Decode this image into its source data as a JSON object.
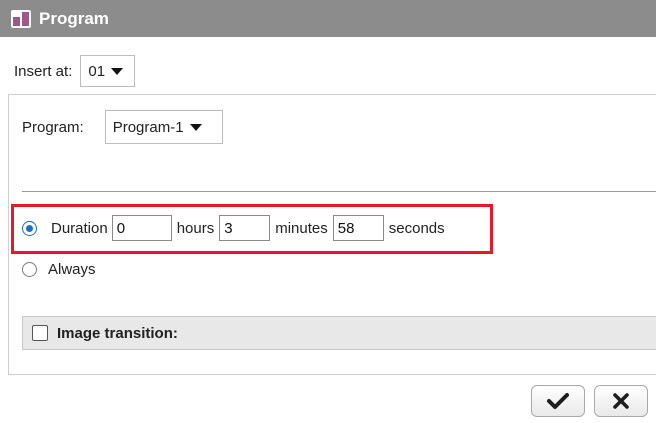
{
  "window": {
    "title": "Program",
    "icon": "program-icon"
  },
  "insert": {
    "label": "Insert at:",
    "value": "01"
  },
  "program": {
    "label": "Program:",
    "value": "Program-1"
  },
  "duration": {
    "label": "Duration",
    "selected": true,
    "hours_value": "0",
    "hours_label": "hours",
    "minutes_value": "3",
    "minutes_label": "minutes",
    "seconds_value": "58",
    "seconds_label": "seconds"
  },
  "always": {
    "label": "Always",
    "selected": false
  },
  "transition": {
    "label": "Image transition:",
    "checked": false
  },
  "buttons": {
    "ok_icon": "checkmark-icon",
    "cancel_icon": "close-icon"
  },
  "colors": {
    "titlebar": "#8c8c8c",
    "highlight": "#e21b2a",
    "radio_selected": "#1b6fc4"
  }
}
